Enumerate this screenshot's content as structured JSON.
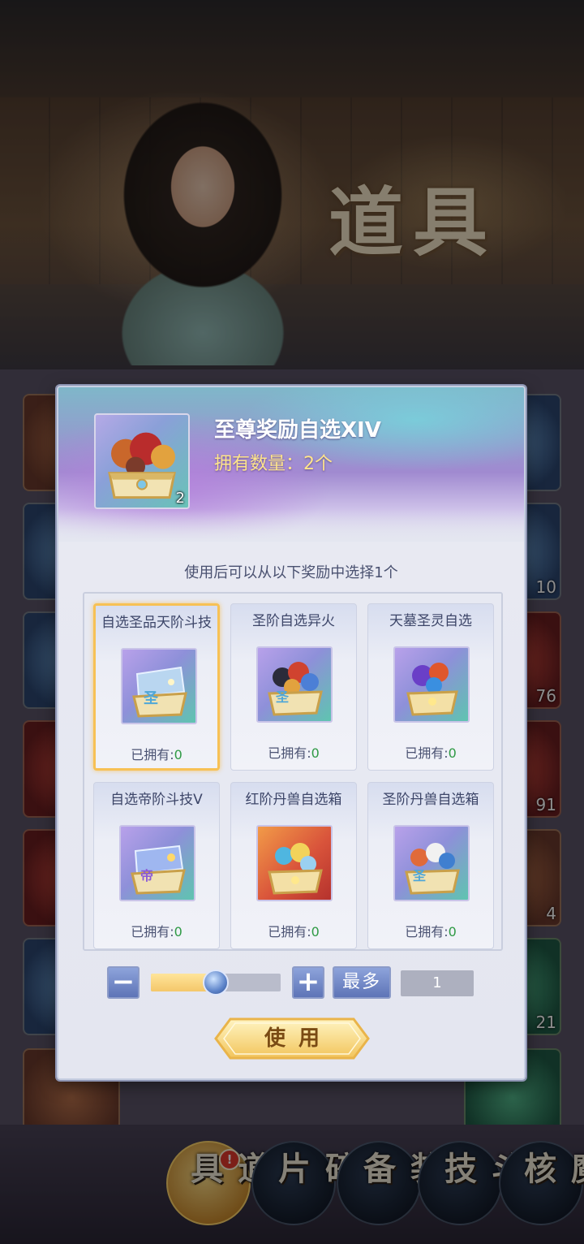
{
  "background": {
    "title": "道具",
    "cell_counts": [
      "10",
      "76",
      "91",
      "4",
      "21"
    ]
  },
  "bottom_nav": {
    "tabs": [
      {
        "label": "道具",
        "active": true,
        "badge": "!"
      },
      {
        "label": "碎片",
        "active": false
      },
      {
        "label": "装备",
        "active": false
      },
      {
        "label": "斗技",
        "active": false
      },
      {
        "label": "魔核",
        "active": false
      }
    ]
  },
  "modal": {
    "item": {
      "name": "至尊奖励自选XIV",
      "owned_label": "拥有数量：2个",
      "count_badge": "2"
    },
    "instruction": "使用后可以从以下奖励中选择1个",
    "rewards": [
      {
        "name": "自选圣品天阶斗技",
        "owned_prefix": "已拥有:",
        "owned": "0",
        "selected": true,
        "style": "purple"
      },
      {
        "name": "圣阶自选异火",
        "owned_prefix": "已拥有:",
        "owned": "0",
        "selected": false,
        "style": "purple"
      },
      {
        "name": "天墓圣灵自选",
        "owned_prefix": "已拥有:",
        "owned": "0",
        "selected": false,
        "style": "purple"
      },
      {
        "name": "自选帝阶斗技V",
        "owned_prefix": "已拥有:",
        "owned": "0",
        "selected": false,
        "style": "purple"
      },
      {
        "name": "红阶丹兽自选箱",
        "owned_prefix": "已拥有:",
        "owned": "0",
        "selected": false,
        "style": "orange"
      },
      {
        "name": "圣阶丹兽自选箱",
        "owned_prefix": "已拥有:",
        "owned": "0",
        "selected": false,
        "style": "purple"
      }
    ],
    "controls": {
      "minus_label": "−",
      "plus_label": "+",
      "max_label": "最多",
      "quantity": "1",
      "slider_fraction": 0.5
    },
    "use_button_label": "使用"
  },
  "colors": {
    "accent_gold": "#f7c155",
    "owned_green": "#2f9a45",
    "button_blue": "#5e74b7"
  }
}
